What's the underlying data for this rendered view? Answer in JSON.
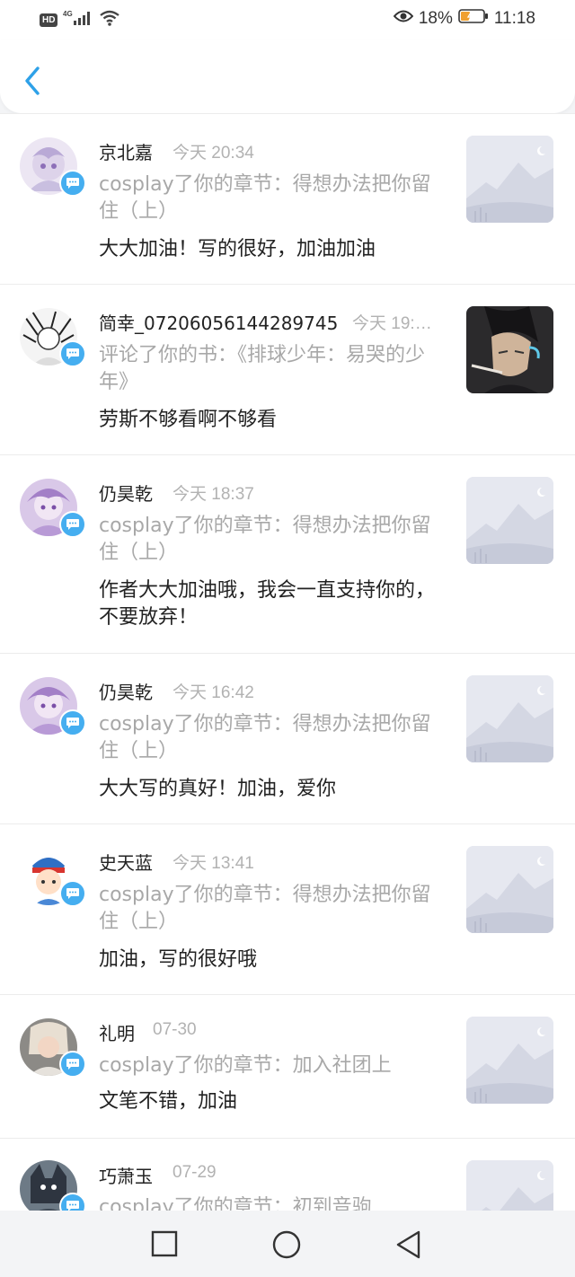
{
  "status_bar": {
    "network": "4G",
    "hd_label": "HD",
    "battery_percent": "18%",
    "time": "11:18"
  },
  "header": {
    "back_icon": "chevron-left-icon"
  },
  "notifications": [
    {
      "user": "京北嘉",
      "time": "今天 20:34",
      "action": "cosplay了你的章节：得想办法把你留住（上）",
      "comment": "大大加油！写的很好，加油加油",
      "thumb": "placeholder"
    },
    {
      "user": "简幸_07206056144289745",
      "time": "今天 19:…",
      "action": "评论了你的书：《排球少年：易哭的少年》",
      "comment": "劳斯不够看啊不够看",
      "thumb": "book-cover"
    },
    {
      "user": "仍昊乾",
      "time": "今天 18:37",
      "action": "cosplay了你的章节：得想办法把你留住（上）",
      "comment": "作者大大加油哦，我会一直支持你的，不要放弃！",
      "thumb": "placeholder"
    },
    {
      "user": "仍昊乾",
      "time": "今天 16:42",
      "action": "cosplay了你的章节：得想办法把你留住（上）",
      "comment": "大大写的真好！加油，爱你",
      "thumb": "placeholder"
    },
    {
      "user": "史天蓝",
      "time": "今天 13:41",
      "action": "cosplay了你的章节：得想办法把你留住（上）",
      "comment": "加油，写的很好哦",
      "thumb": "placeholder"
    },
    {
      "user": "礼明",
      "time": "07-30",
      "action": "cosplay了你的章节：加入社团上",
      "comment": "文笔不错，加油",
      "thumb": "placeholder"
    },
    {
      "user": "巧萧玉",
      "time": "07-29",
      "action": "cosplay了你的章节：初到音驹",
      "comment": "",
      "thumb": "placeholder"
    }
  ],
  "nav_bar": {
    "recent_icon": "square-icon",
    "home_icon": "circle-icon",
    "back_icon": "triangle-back-icon"
  },
  "colors": {
    "accent_blue": "#45aef0",
    "background": "#f3f4f6",
    "secondary_text": "#a8a8a8"
  }
}
